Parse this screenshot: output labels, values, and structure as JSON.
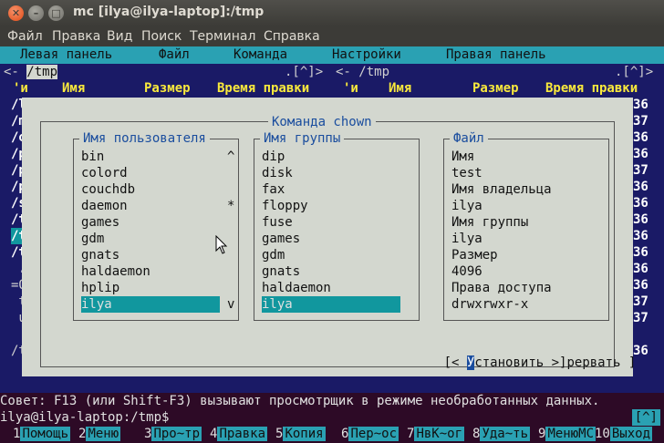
{
  "window": {
    "title": "mc [ilya@ilya-laptop]:/tmp"
  },
  "menubar": [
    "Файл",
    "Правка",
    "Вид",
    "Поиск",
    "Терминал",
    "Справка"
  ],
  "mc_menu": [
    "Левая панель",
    "Файл",
    "Команда",
    "Настройки",
    "Правая панель"
  ],
  "left_panel": {
    "title": "/tmp",
    "corner": ".[^]>",
    "prefix": "<-",
    "columns": [
      "'и",
      "Имя",
      "Размер",
      "Время правки"
    ],
    "rows": [
      "/l",
      "/m",
      "/o",
      "/p",
      "/p",
      "/p",
      "/s",
      "/t",
      "/t",
      "/t",
      " .",
      "=O",
      " t",
      " u",
      "",
      "/t"
    ]
  },
  "right_panel": {
    "title": "/tmp",
    "corner": ".[^]>",
    "prefix": "<-",
    "columns": [
      "'и",
      "Имя",
      "Размер",
      "Время правки"
    ],
    "nums": [
      "36",
      "37",
      "36",
      "36",
      "37",
      "36",
      "36",
      "36",
      "36",
      "36",
      "36",
      "36",
      "37",
      "37",
      "",
      "36"
    ]
  },
  "dialog": {
    "title": "Команда chown",
    "user_box": {
      "title": "Имя пользователя",
      "items": [
        "bin",
        "colord",
        "couchdb",
        "daemon",
        "games",
        "gdm",
        "gnats",
        "haldaemon",
        "hplip",
        "ilya"
      ],
      "selected": "ilya",
      "marks": [
        "^",
        "*",
        "v"
      ]
    },
    "group_box": {
      "title": "Имя группы",
      "items": [
        "dip",
        "disk",
        "fax",
        "floppy",
        "fuse",
        "games",
        "gdm",
        "gnats",
        "haldaemon",
        "ilya"
      ],
      "selected": "ilya"
    },
    "file_box": {
      "title": "Файл",
      "items": [
        "Имя",
        "test",
        "Имя владельца",
        "ilya",
        "Имя группы",
        "ilya",
        "Размер",
        "4096",
        "Права доступа",
        "drwxrwxr-x"
      ]
    },
    "buttons": {
      "set_pre": "[< ",
      "set_hot": "У",
      "set_rest": "становить >]",
      "cancel": "рервать ]"
    }
  },
  "hint": "Совет: F13 (или Shift-F3) вызывают просмотрщик в режиме необработанных данных.",
  "prompt": "ilya@ilya-laptop:/tmp$",
  "scroll_indicator": "[^]",
  "fkeys": [
    {
      "n": "1",
      "l": "Помощь"
    },
    {
      "n": "2",
      "l": "Меню"
    },
    {
      "n": "3",
      "l": "Про~тр"
    },
    {
      "n": "4",
      "l": "Правка"
    },
    {
      "n": "5",
      "l": "Копия"
    },
    {
      "n": "6",
      "l": "Пер~ос"
    },
    {
      "n": "7",
      "l": "НвК~ог"
    },
    {
      "n": "8",
      "l": "Уда~ть"
    },
    {
      "n": "9",
      "l": "МенюМС"
    },
    {
      "n": "10",
      "l": "Выход"
    }
  ]
}
